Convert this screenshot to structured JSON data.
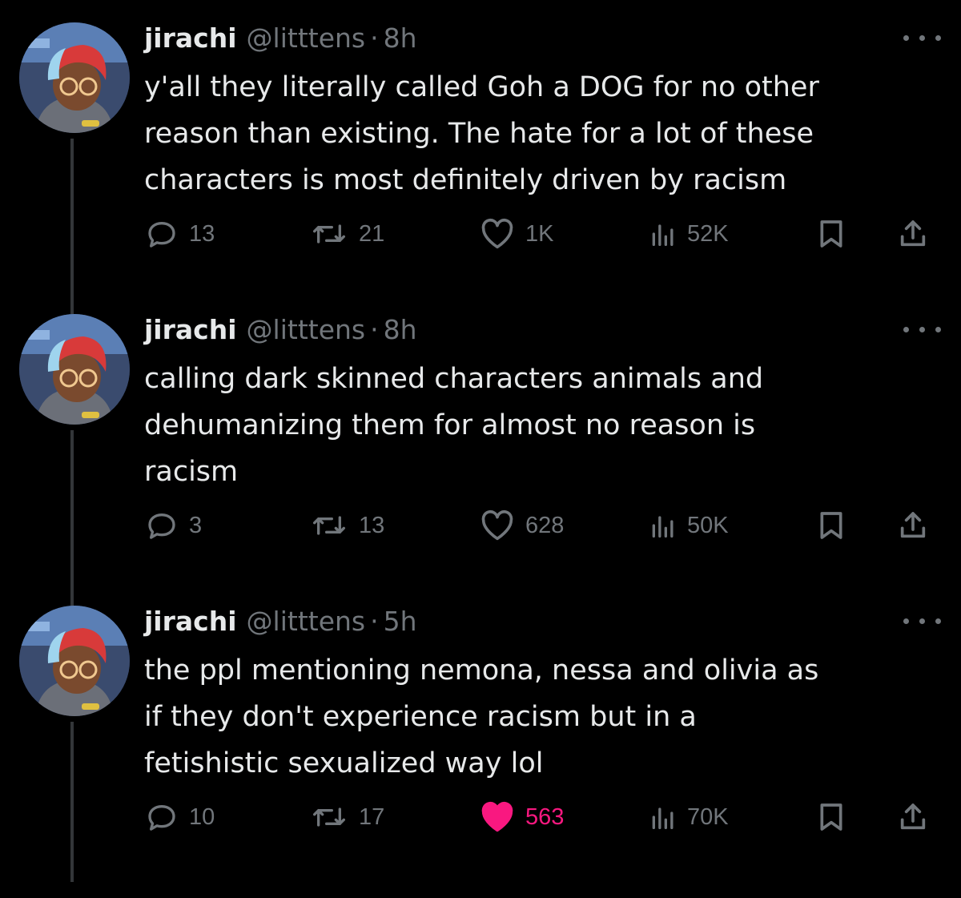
{
  "colors": {
    "background": "#000000",
    "text": "#e7e9ea",
    "muted": "#71767b",
    "like_active": "#f91880"
  },
  "tweets": [
    {
      "author": {
        "name": "jirachi",
        "handle": "@litttens",
        "time": "8h",
        "avatar": "avatar-icon"
      },
      "separator": "·",
      "text": "y'all they literally called Goh a DOG for no other\nreason than existing. The hate for a lot of these\ncharacters is most definitely driven by racism",
      "replies": "13",
      "retweets": "21",
      "likes": "1K",
      "views": "52K",
      "liked": false
    },
    {
      "author": {
        "name": "jirachi",
        "handle": "@litttens",
        "time": "8h",
        "avatar": "avatar-icon"
      },
      "separator": "·",
      "text": "calling dark skinned characters animals and\ndehumanizing them for almost no reason is\nracism",
      "replies": "3",
      "retweets": "13",
      "likes": "628",
      "views": "50K",
      "liked": false
    },
    {
      "author": {
        "name": "jirachi",
        "handle": "@litttens",
        "time": "5h",
        "avatar": "avatar-icon"
      },
      "separator": "·",
      "text": "the ppl mentioning nemona, nessa and olivia as\nif they don't experience racism but in a\nfetishistic sexualized way lol",
      "replies": "10",
      "retweets": "17",
      "likes": "563",
      "views": "70K",
      "liked": true
    }
  ]
}
